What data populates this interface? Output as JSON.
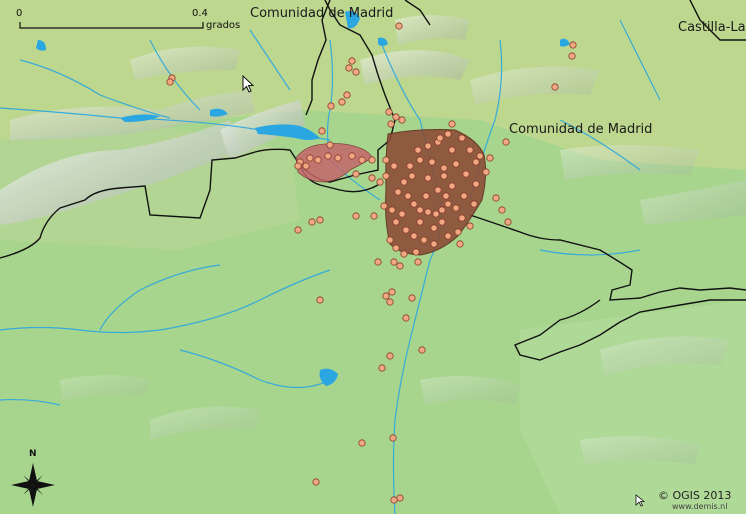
{
  "labels": {
    "region_top": "Comunidad de Madrid",
    "region_center": "Comunidad de Madrid",
    "region_top_right": "Castilla-La"
  },
  "scale_bar": {
    "start": "0",
    "end": "0.4",
    "unit": "grados"
  },
  "north_arrow": {
    "label": "N"
  },
  "credits": {
    "main": "© OGIS 2013",
    "url": "www.demis.nl"
  },
  "colors": {
    "land": "#a9d28c",
    "water": "#2aa6e0",
    "border": "#111111",
    "range_polygon": "#8b4a36",
    "range_polygon_small": "#c2656a",
    "occurrence_point": "#f0a883",
    "occurrence_point_outline": "#8a3a2a"
  }
}
